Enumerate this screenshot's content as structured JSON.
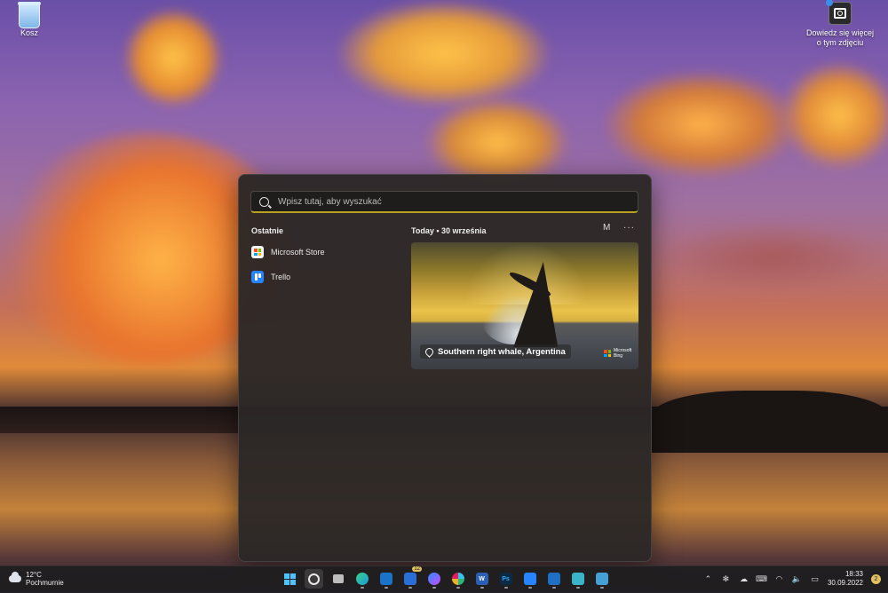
{
  "desktop": {
    "recycle_bin_label": "Kosz",
    "spotlight_label": "Dowiedz się więcej o tym zdjęciu"
  },
  "search": {
    "placeholder": "Wpisz tutaj, aby wyszukać"
  },
  "recent": {
    "title": "Ostatnie",
    "items": [
      {
        "label": "Microsoft Store",
        "icon": "microsoft-store-icon"
      },
      {
        "label": "Trello",
        "icon": "trello-icon"
      }
    ]
  },
  "today": {
    "title": "Today • 30 września",
    "avatar_label": "M",
    "more_label": "···",
    "card_caption": "Southern right whale, Argentina",
    "card_badge": "Microsoft Bing"
  },
  "taskbar": {
    "temperature": "12°C",
    "condition": "Pochmurnie",
    "apps": [
      {
        "name": "start",
        "color": "#4cc2ff"
      },
      {
        "name": "search",
        "color": "#e8e8e8",
        "active": true
      },
      {
        "name": "task-view",
        "color": "#bdbdbd"
      },
      {
        "name": "edge",
        "color": "#1c9bd8"
      },
      {
        "name": "mail",
        "color": "#1a73c8"
      },
      {
        "name": "store-badge",
        "color": "#2a6ed8",
        "badge": "12"
      },
      {
        "name": "messenger",
        "color": "#9a5cff"
      },
      {
        "name": "slack",
        "color": "#e9e9e9"
      },
      {
        "name": "word",
        "color": "#2b5fb4",
        "text": "W"
      },
      {
        "name": "photoshop",
        "color": "#0c2a44",
        "text": "Ps"
      },
      {
        "name": "trello",
        "color": "#2684ff"
      },
      {
        "name": "outlook",
        "color": "#1f6fc5"
      },
      {
        "name": "files",
        "color": "#3cb4c8"
      },
      {
        "name": "snip",
        "color": "#46a0d8"
      }
    ],
    "time": "18:33",
    "date": "30.09.2022",
    "notifications": "2"
  }
}
